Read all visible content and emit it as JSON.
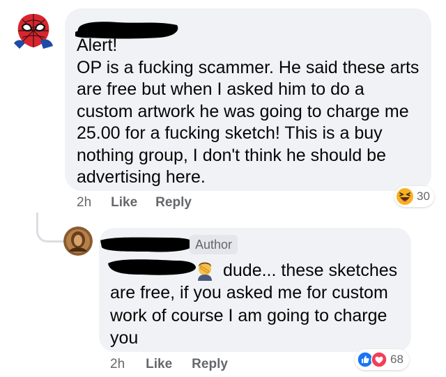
{
  "top_comment": {
    "text": "Alert!\nOP is a fucking scammer. He said these arts are free but when I asked him to do a custom artwork he was going to charge me 25.00 for a fucking sketch! This is a buy nothing group, I don't think he should be advertising here.",
    "time": "2h",
    "like_label": "Like",
    "reply_label": "Reply",
    "reaction": {
      "icon": "haha-reaction-icon",
      "count": "30"
    },
    "avatar_icon": "spiderman-avatar"
  },
  "reply_comment": {
    "author_badge": "Author",
    "text_first_line": "dude... these sketches",
    "text_rest": "are free, if you asked me for custom\nwork of course I am going to charge\nyou",
    "time": "2h",
    "like_label": "Like",
    "reply_label": "Reply",
    "reactions": [
      "like-reaction-icon",
      "love-reaction-icon"
    ],
    "reaction_count": "68",
    "inline_emoji": "facepalm-emoji"
  },
  "colors": {
    "bubble": "#f0f2f5",
    "meta_text": "#65676b",
    "like_blue": "#1877f2",
    "love_red": "#f33e58",
    "haha_yellow": "#f7b125",
    "redaction": "#000000"
  }
}
